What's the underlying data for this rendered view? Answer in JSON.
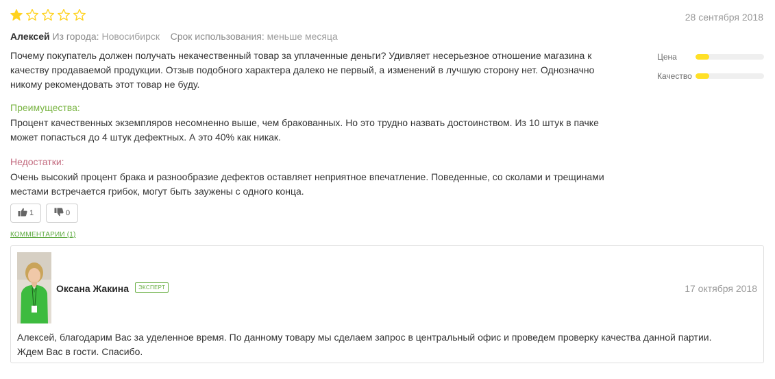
{
  "review": {
    "rating": 1,
    "max_rating": 5,
    "star_icons": [
      "star-filled-icon",
      "star-empty-icon",
      "star-empty-icon",
      "star-empty-icon",
      "star-empty-icon"
    ],
    "date": "28 сентября 2018",
    "author": "Алексей",
    "city_label": "Из города:",
    "city": "Новосибирск",
    "usage_label": "Срок использования:",
    "usage": "меньше месяца",
    "text_line1": "Почему покупатель должен получать некачественный товар за уплаченные деньги? Удивляет несерьезное отношение магазина к",
    "text_line2": "качеству продаваемой продукции. Отзыв подобного характера далеко не первый, а изменений в лучшую сторону нет. Однозначно",
    "text_line3": "никому рекомендовать этот товар не буду.",
    "pros_title": "Преимущества:",
    "pros_line1": "Процент качественных экземпляров несомненно выше, чем бракованных. Но это трудно назвать достоинством. Из 10 штук в пачке",
    "pros_line2": "может попасться до 4 штук дефектных. А это 40% как никак.",
    "cons_title": "Недостатки:",
    "cons_line1": "Очень высокий процент брака и разнообразие дефектов оставляет неприятное впечатление. Поведенные, со сколами и трещинами",
    "cons_line2": "местами встречается грибок, могут быть заужены с одного конца.",
    "ratings": [
      {
        "label": "Цена",
        "fraction": 0.2
      },
      {
        "label": "Качество",
        "fraction": 0.2
      }
    ],
    "likes": "1",
    "dislikes": "0",
    "comments_link": "КОММЕНТАРИИ (1)"
  },
  "reply": {
    "name": "Оксана Жакина",
    "badge": "ЭКСПЕРТ",
    "date": "17 октября 2018",
    "line1": "Алексей, благодарим Вас за уделенное время. По данному товару мы сделаем запрос в центральный офис и проведем проверку качества данной партии.",
    "line2": "Ждем Вас в гости. Спасибо."
  },
  "colors": {
    "star": "#ffd21f",
    "star_empty_stroke": "#ffd21f",
    "pros": "#79b442",
    "cons": "#c26a7e",
    "link": "#5aa83c",
    "bar_fill": "#ffe026"
  }
}
